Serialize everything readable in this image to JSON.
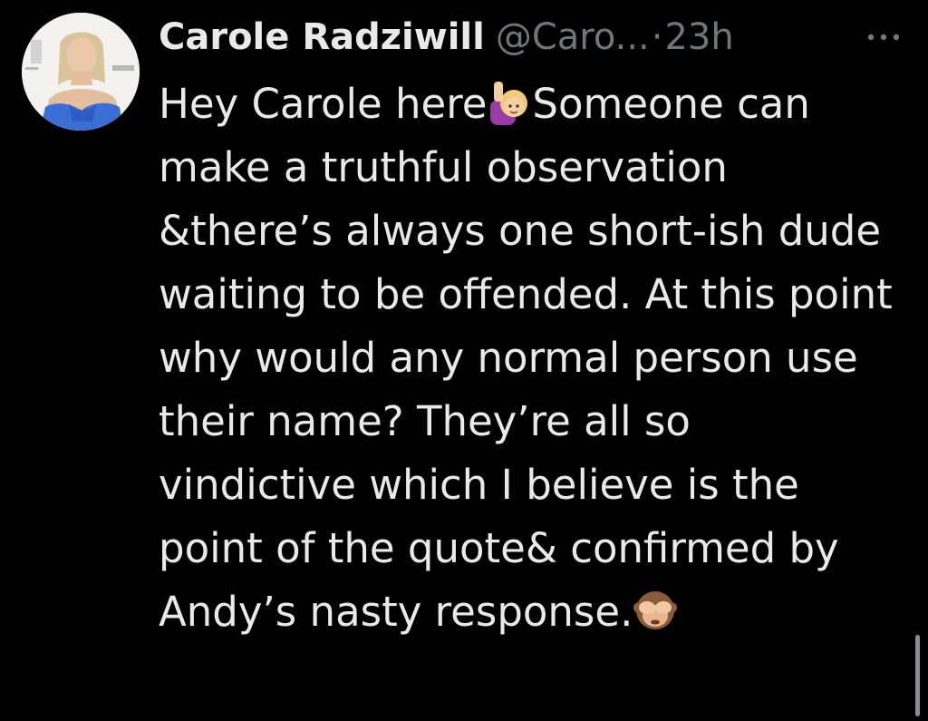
{
  "tweet": {
    "author": {
      "display_name": "Carole Radziwill",
      "handle": "@Caro...",
      "avatar_icon": "profile-photo"
    },
    "separator": "·",
    "timestamp": "23h",
    "more_icon": "more-horizontal-icon",
    "text_segments": [
      "Hey Carole here",
      "Someone can make a truthful observation &there’s always one short-ish dude waiting to be offended. At this point why would any normal person use their name? They’re all so vindictive which I believe is the point of the quote& confirmed by Andy’s nasty response."
    ],
    "emojis": [
      {
        "name": "person-raising-hand-emoji",
        "glyph": "🙋🏼‍♀️"
      },
      {
        "name": "see-no-evil-monkey-emoji",
        "glyph": "🙈"
      }
    ]
  },
  "colors": {
    "background": "#000000",
    "primary_text": "#e7e9ea",
    "secondary_text": "#71767b"
  }
}
